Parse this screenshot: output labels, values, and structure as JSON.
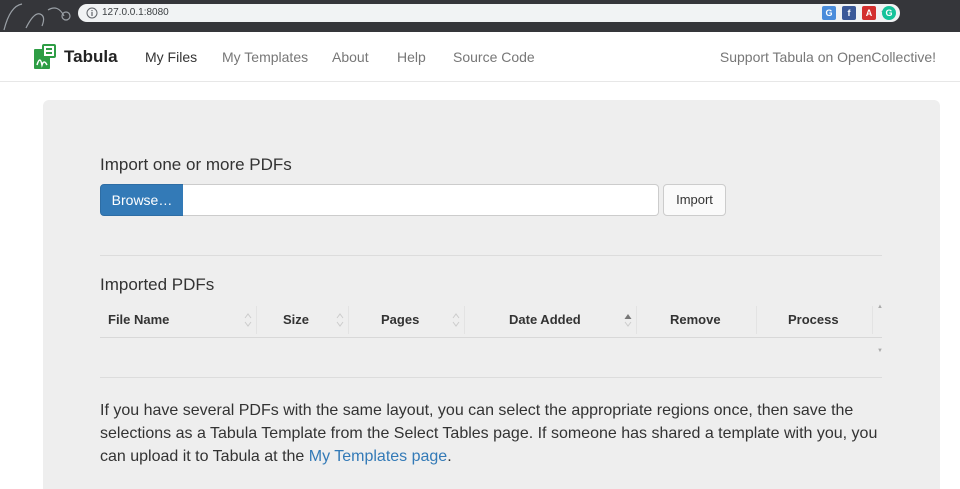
{
  "browser": {
    "url": "127.0.0.1:8080",
    "zoom_icon": "zoom-icon",
    "star_icon": "bookmark-star-icon",
    "extensions": [
      {
        "name": "translate-extension-icon",
        "color": "#4a8cdb",
        "glyph": "G"
      },
      {
        "name": "facebook-extension-icon",
        "color": "#3b5998",
        "glyph": "f"
      },
      {
        "name": "pdf-extension-icon",
        "color": "#d32f2f",
        "glyph": "A"
      },
      {
        "name": "grammarly-extension-icon",
        "color": "#15c39a",
        "glyph": "G"
      }
    ]
  },
  "navbar": {
    "brand": "Tabula",
    "items": [
      "My Files",
      "My Templates",
      "About",
      "Help",
      "Source Code"
    ],
    "support": "Support Tabula on OpenCollective!"
  },
  "import": {
    "title": "Import one or more PDFs",
    "browse_label": "Browse…",
    "file_value": "",
    "import_label": "Import"
  },
  "imported": {
    "title": "Imported PDFs",
    "columns": [
      "File Name",
      "Size",
      "Pages",
      "Date Added",
      "Remove",
      "Process"
    ],
    "rows": []
  },
  "info": {
    "text_before": "If you have several PDFs with the same layout, you can select the appropriate regions once, then save the selections as a Tabula Template from the Select Tables page. If someone has shared a template with you, you can upload it to Tabula at the ",
    "link": "My Templates page",
    "text_after": "."
  },
  "colors": {
    "primary": "#337ab7",
    "panel": "#eeeeee",
    "brand_green": "#2e9d45"
  }
}
